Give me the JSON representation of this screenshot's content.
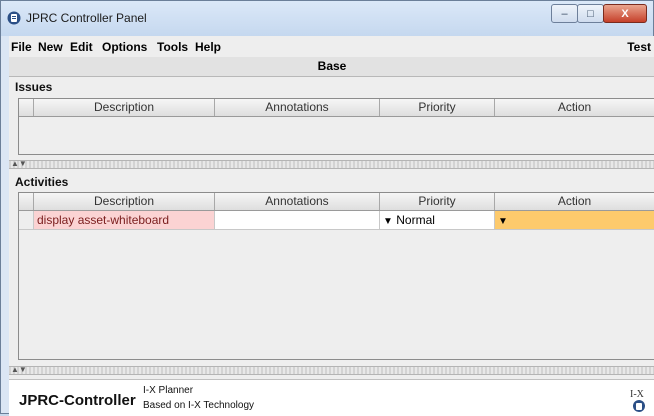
{
  "window": {
    "title": "JPRC Controller Panel",
    "minimize_glyph": "–",
    "maximize_glyph": "□",
    "close_glyph": "X"
  },
  "menubar": {
    "items": [
      "File",
      "New",
      "Edit",
      "Options",
      "Tools",
      "Help"
    ],
    "right_label": "Test"
  },
  "panel_title": "Base",
  "issues": {
    "label": "Issues",
    "columns": [
      "Description",
      "Annotations",
      "Priority",
      "Action"
    ],
    "rows": []
  },
  "activities": {
    "label": "Activities",
    "columns": [
      "Description",
      "Annotations",
      "Priority",
      "Action"
    ],
    "rows": [
      {
        "description": "display asset-whiteboard",
        "annotations": "",
        "priority": "Normal",
        "action": ""
      }
    ]
  },
  "footer": {
    "brand": "JPRC-Controller",
    "line1": "I-X Planner",
    "line2": "Based on I-X Technology",
    "logo_text": "I-X"
  },
  "colors": {
    "description_cell": "#fbd3d3",
    "action_cell": "#fdca6c",
    "titlebar": "#c5d8ef"
  },
  "icons": [
    "app-icon",
    "dropdown-triangle-icon",
    "splitter-arrows-icon",
    "ix-logo-icon"
  ]
}
